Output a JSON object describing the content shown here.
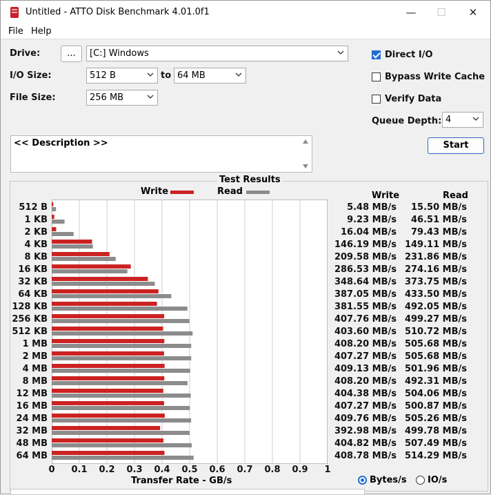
{
  "window": {
    "title": "Untitled - ATTO Disk Benchmark 4.01.0f1",
    "controls": {
      "minimize": "—",
      "maximize": "☐",
      "close": "✕"
    }
  },
  "menu": [
    "File",
    "Help"
  ],
  "form": {
    "drive_label": "Drive:",
    "browse_label": "...",
    "drive_value": "[C:] Windows",
    "io_size_label": "I/O Size:",
    "io_from": "512 B",
    "to_label": "to",
    "io_to": "64 MB",
    "file_size_label": "File Size:",
    "file_size": "256 MB",
    "description": "<< Description >>"
  },
  "options": {
    "direct_io": {
      "label": "Direct I/O",
      "checked": true
    },
    "bypass_write_cache": {
      "label": "Bypass Write Cache",
      "checked": false
    },
    "verify_data": {
      "label": "Verify Data",
      "checked": false
    },
    "queue_depth_label": "Queue Depth:",
    "queue_depth": "4",
    "start_label": "Start"
  },
  "results": {
    "title": "Test Results",
    "write_legend": "Write",
    "read_legend": "Read",
    "write_header": "Write",
    "read_header": "Read",
    "x_axis_title": "Transfer Rate - GB/s",
    "units": {
      "bytes": "Bytes/s",
      "io": "IO/s",
      "selected": "bytes"
    }
  },
  "chart_data": {
    "type": "bar",
    "orientation": "horizontal",
    "categories": [
      "512 B",
      "1 KB",
      "2 KB",
      "4 KB",
      "8 KB",
      "16 KB",
      "32 KB",
      "64 KB",
      "128 KB",
      "256 KB",
      "512 KB",
      "1 MB",
      "2 MB",
      "4 MB",
      "8 MB",
      "12 MB",
      "16 MB",
      "24 MB",
      "32 MB",
      "48 MB",
      "64 MB"
    ],
    "series": [
      {
        "name": "Write",
        "color": "#cc2222",
        "values": [
          0.00548,
          0.00923,
          0.01604,
          0.14619,
          0.20958,
          0.28653,
          0.34864,
          0.38705,
          0.38155,
          0.40776,
          0.4036,
          0.4082,
          0.40727,
          0.40913,
          0.4082,
          0.40438,
          0.40727,
          0.40976,
          0.39298,
          0.40482,
          0.40878
        ],
        "labels": [
          "5.48 MB/s",
          "9.23 MB/s",
          "16.04 MB/s",
          "146.19 MB/s",
          "209.58 MB/s",
          "286.53 MB/s",
          "348.64 MB/s",
          "387.05 MB/s",
          "381.55 MB/s",
          "407.76 MB/s",
          "403.60 MB/s",
          "408.20 MB/s",
          "407.27 MB/s",
          "409.13 MB/s",
          "408.20 MB/s",
          "404.38 MB/s",
          "407.27 MB/s",
          "409.76 MB/s",
          "392.98 MB/s",
          "404.82 MB/s",
          "408.78 MB/s"
        ]
      },
      {
        "name": "Read",
        "color": "#8c8c8c",
        "values": [
          0.0155,
          0.04651,
          0.07943,
          0.14911,
          0.23186,
          0.27416,
          0.37375,
          0.4335,
          0.49205,
          0.49927,
          0.51072,
          0.50568,
          0.50568,
          0.50196,
          0.49231,
          0.50406,
          0.50087,
          0.50526,
          0.49978,
          0.50749,
          0.51429
        ],
        "labels": [
          "15.50 MB/s",
          "46.51 MB/s",
          "79.43 MB/s",
          "149.11 MB/s",
          "231.86 MB/s",
          "274.16 MB/s",
          "373.75 MB/s",
          "433.50 MB/s",
          "492.05 MB/s",
          "499.27 MB/s",
          "510.72 MB/s",
          "505.68 MB/s",
          "505.68 MB/s",
          "501.96 MB/s",
          "492.31 MB/s",
          "504.06 MB/s",
          "500.87 MB/s",
          "505.26 MB/s",
          "499.78 MB/s",
          "507.49 MB/s",
          "514.29 MB/s"
        ]
      }
    ],
    "xlim": [
      0,
      1
    ],
    "xticks": [
      "0",
      "0.1",
      "0.2",
      "0.3",
      "0.4",
      "0.5",
      "0.6",
      "0.7",
      "0.8",
      "0.9",
      "1"
    ],
    "xlabel": "Transfer Rate - GB/s",
    "grid": true
  }
}
